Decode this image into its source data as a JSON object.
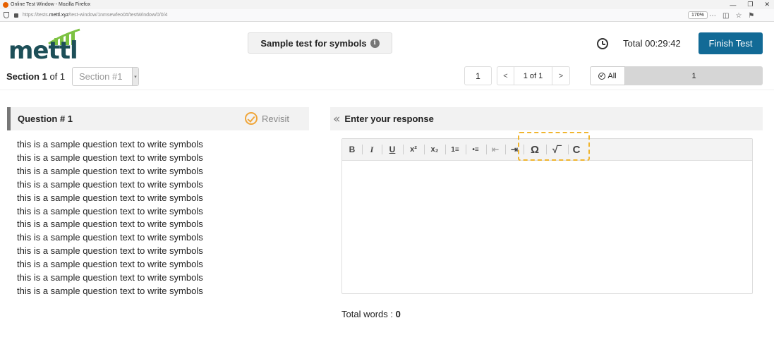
{
  "browser": {
    "window_title": "Online Test Window - Mozilla Firefox",
    "url_prefix": "https://tests.",
    "url_domain": "mettl.xyz",
    "url_rest": "/test-window/1nmsewfeo0#/testWindow/0/0/4",
    "zoom": "170%"
  },
  "header": {
    "logo_text": "mettl",
    "test_title": "Sample test for symbols",
    "timer_label": "Total",
    "timer_value": "00:29:42",
    "finish_label": "Finish Test"
  },
  "section": {
    "label_prefix": "Section",
    "number": "1",
    "of_text": "of 1",
    "select_value": "Section #1"
  },
  "pager": {
    "current": "1",
    "prev": "<",
    "of_text": "1 of 1",
    "next": ">"
  },
  "filter": {
    "all_label": "All",
    "question_number": "1"
  },
  "question": {
    "title": "Question # 1",
    "revisit_label": "Revisit",
    "lines": [
      "this is a sample question text to write symbols",
      "this is a sample question text to write symbols",
      "this is a sample question text to write symbols",
      "this is a sample question text to write symbols",
      "this is a sample question text to write symbols",
      "this is a sample question text to write symbols",
      "this is a sample question text to write symbols",
      "this is a sample question text to write symbols",
      "this is a sample question text to write symbols",
      "this is a sample question text to write symbols",
      "this is a sample question text to write symbols",
      "this is a sample question text to write symbols"
    ]
  },
  "response": {
    "title": "Enter your response",
    "toolbar": {
      "bold": "B",
      "italic": "I",
      "underline": "U",
      "superscript": "x²",
      "subscript": "x₂",
      "numbered_list": "1≡",
      "bullet_list": "•≡",
      "outdent": "⇤",
      "indent": "⇥",
      "special_char": "Ω",
      "math": "√‾",
      "clear": "C"
    },
    "word_count_label": "Total words :",
    "word_count_value": "0"
  },
  "colors": {
    "brand_dark": "#1d4f58",
    "brand_green": "#7cc242",
    "finish_button": "#126a96",
    "revisit": "#f0a63a",
    "highlight": "#f0b52f"
  }
}
